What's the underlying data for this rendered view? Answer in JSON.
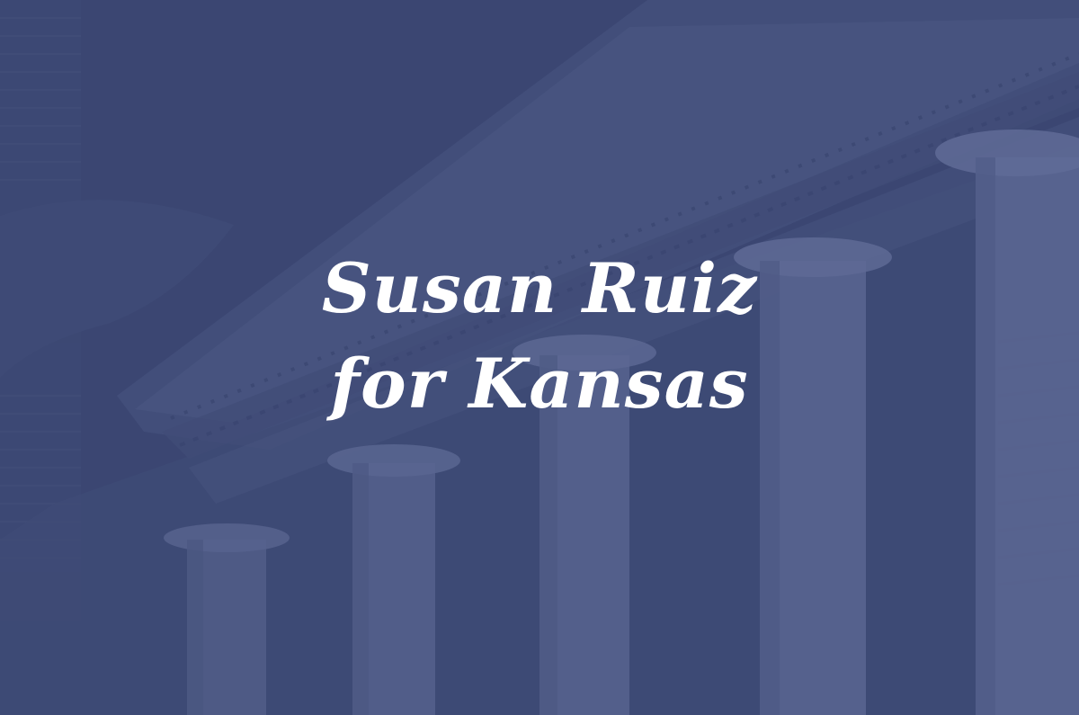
{
  "hero": {
    "title_line1": "Susan Ruiz",
    "title_line2": "for Kansas",
    "background_image": "neoclassical-government-building-columns",
    "overlay_color": "#3b4772",
    "text_color": "#ffffff"
  }
}
